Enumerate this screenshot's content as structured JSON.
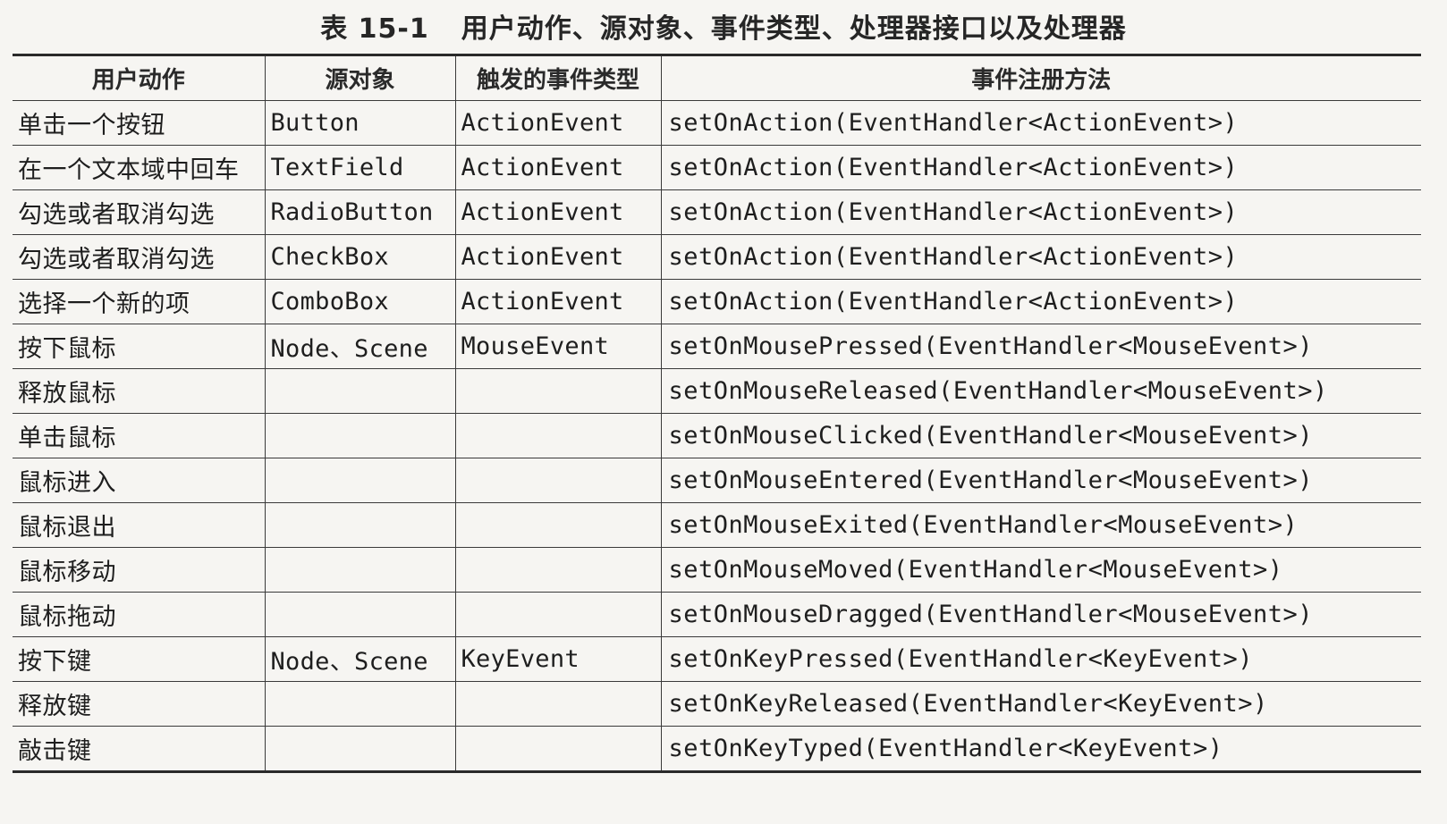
{
  "caption": {
    "number": "表 15-1",
    "title": "用户动作、源对象、事件类型、处理器接口以及处理器"
  },
  "table": {
    "headers": [
      "用户动作",
      "源对象",
      "触发的事件类型",
      "事件注册方法"
    ],
    "rows": [
      [
        "单击一个按钮",
        "Button",
        "ActionEvent",
        "setOnAction(EventHandler<ActionEvent>)"
      ],
      [
        "在一个文本域中回车",
        "TextField",
        "ActionEvent",
        "setOnAction(EventHandler<ActionEvent>)"
      ],
      [
        "勾选或者取消勾选",
        "RadioButton",
        "ActionEvent",
        "setOnAction(EventHandler<ActionEvent>)"
      ],
      [
        "勾选或者取消勾选",
        "CheckBox",
        "ActionEvent",
        "setOnAction(EventHandler<ActionEvent>)"
      ],
      [
        "选择一个新的项",
        "ComboBox",
        "ActionEvent",
        "setOnAction(EventHandler<ActionEvent>)"
      ],
      [
        "按下鼠标",
        "Node、Scene",
        "MouseEvent",
        "setOnMousePressed(EventHandler<MouseEvent>)"
      ],
      [
        "释放鼠标",
        "",
        "",
        "setOnMouseReleased(EventHandler<MouseEvent>)"
      ],
      [
        "单击鼠标",
        "",
        "",
        "setOnMouseClicked(EventHandler<MouseEvent>)"
      ],
      [
        "鼠标进入",
        "",
        "",
        "setOnMouseEntered(EventHandler<MouseEvent>)"
      ],
      [
        "鼠标退出",
        "",
        "",
        "setOnMouseExited(EventHandler<MouseEvent>)"
      ],
      [
        "鼠标移动",
        "",
        "",
        "setOnMouseMoved(EventHandler<MouseEvent>)"
      ],
      [
        "鼠标拖动",
        "",
        "",
        "setOnMouseDragged(EventHandler<MouseEvent>)"
      ],
      [
        "按下键",
        "Node、Scene",
        "KeyEvent",
        "setOnKeyPressed(EventHandler<KeyEvent>)"
      ],
      [
        "释放键",
        "",
        "",
        "setOnKeyReleased(EventHandler<KeyEvent>)"
      ],
      [
        "敲击键",
        "",
        "",
        "setOnKeyTyped(EventHandler<KeyEvent>)"
      ]
    ]
  }
}
